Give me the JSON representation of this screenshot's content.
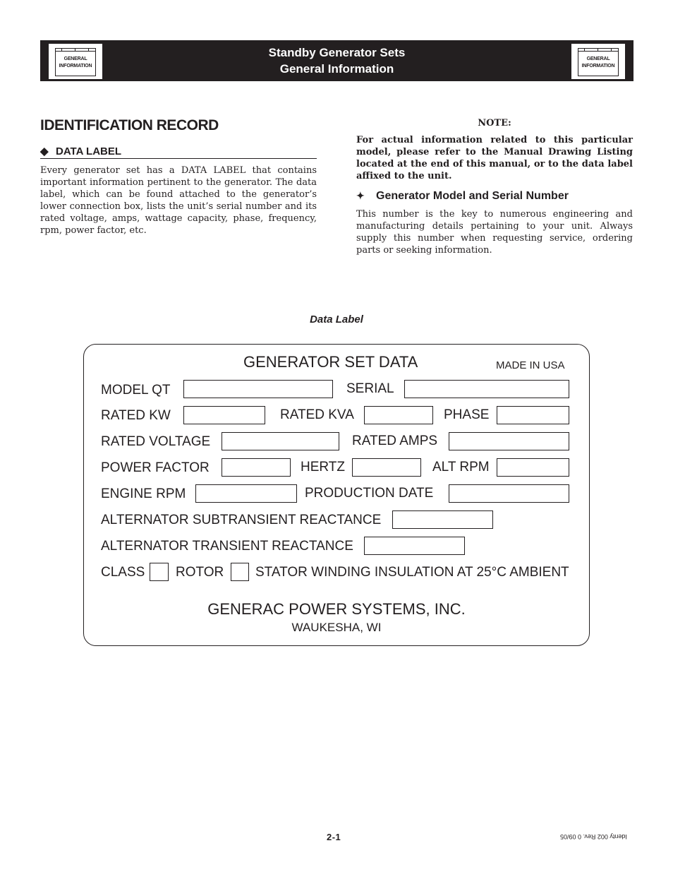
{
  "header": {
    "title_line1": "Standby Generator Sets",
    "title_line2": "General Information",
    "tab_icon_label_line1": "GENERAL",
    "tab_icon_label_line2": "INFORMATION"
  },
  "section": {
    "title": "IDENTIFICATION RECORD",
    "subhead_bullet": "◆",
    "subhead": "DATA LABEL",
    "body": "Every generator set has a DATA LABEL that contains important information pertinent to the generator. The data label, which can be found attached to the generator’s lower connection box, lists the unit’s serial number and its rated voltage, amps, wattage capacity, phase, frequency, rpm, power factor, etc."
  },
  "note": {
    "title": "NOTE:",
    "body": "For actual information related to this particular model, please refer to the Manual Drawing Listing located at the end of this manual, or to the data label affixed to the unit."
  },
  "model_serial": {
    "bullet": "✦",
    "heading": "Generator Model and Serial Number",
    "body": "This number is the key to numerous engineering and manufacturing details pertaining to your unit. Always supply this number when requesting service, ordering parts or seeking information."
  },
  "figure": {
    "caption": "Data Label",
    "title": "GENERATOR SET DATA",
    "made_in": "MADE IN USA",
    "fields": {
      "model": "MODEL  QT",
      "serial": "SERIAL",
      "rated_kw": "RATED KW",
      "rated_kva": "RATED KVA",
      "phase": "PHASE",
      "rated_voltage": "RATED VOLTAGE",
      "rated_amps": "RATED AMPS",
      "power_factor": "POWER FACTOR",
      "hertz": "HERTZ",
      "alt_rpm": "ALT RPM",
      "engine_rpm": "ENGINE RPM",
      "production_date": "PRODUCTION DATE",
      "subtransient": "ALTERNATOR SUBTRANSIENT REACTANCE",
      "transient": "ALTERNATOR TRANSIENT REACTANCE",
      "class": "CLASS",
      "rotor": "ROTOR",
      "stator": "STATOR  WINDING INSULATION AT 25°C AMBIENT"
    },
    "company": "GENERAC POWER SYSTEMS, INC.",
    "location": "WAUKESHA, WI"
  },
  "footer": {
    "page_number": "2-1",
    "doc_id": "Identy 002  Rev. 0  09/05"
  }
}
